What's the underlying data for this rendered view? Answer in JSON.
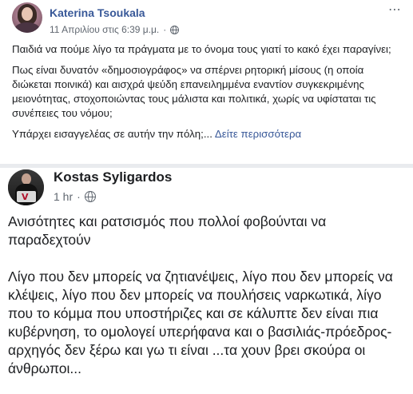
{
  "post1": {
    "author": "Katerina Tsoukala",
    "timestamp": "11 Απριλίου στις 6:39 μ.μ.",
    "separator": "·",
    "more_icon": "⋯",
    "paragraphs": [
      "Παιδιά να πούμε λίγο τα πράγματα με το όνομα τους γιατί το κακό έχει παραγίνει;",
      "Πως είναι δυνατόν «δημοσιογράφος» να σπέρνει ρητορική μίσους (η οποία διώκεται ποινικά) και αισχρά ψεύδη επανειλημμένα εναντίον συγκεκριμένης μειονότητας, στοχοποιώντας τους μάλιστα και πολιτικά, χωρίς να υφίσταται τις συνέπειες του νόμου;",
      "Υπάρχει εισαγγελέας σε αυτήν την πόλη;..."
    ],
    "see_more": "Δείτε περισσότερα"
  },
  "post2": {
    "author": "Kostas Syligardos",
    "timestamp": "1 hr",
    "separator": "·",
    "headline": "Ανισότητες και ρατσισμός που πολλοί φοβούνται να παραδεχτούν",
    "body": "Λίγο που δεν μπορείς να ζητιανέψεις, λίγο που δεν μπορείς να κλέψεις, λίγο που δεν μπορείς να πουλήσεις ναρκωτικά, λίγο που το κόμμα που υποστήριζες και σε κάλυπτε δεν είναι πια κυβέρνηση, το ομολογεί υπερήφανα και ο βασιλιάς-πρόεδρος-αρχηγός δεν ξέρω και γω τι είναι  ...τα χουν βρει σκούρα οι άνθρωποι...",
    "avatar_letter": "V"
  }
}
